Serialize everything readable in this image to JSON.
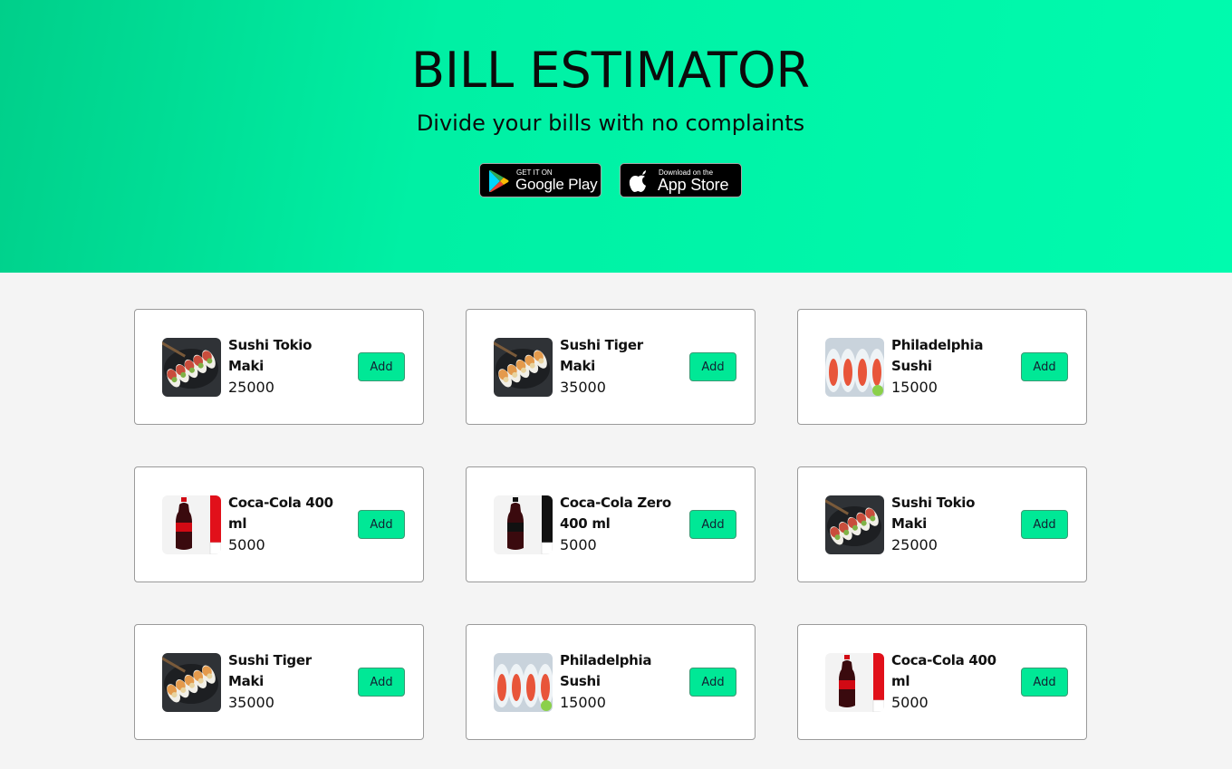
{
  "hero": {
    "title": "BILL ESTIMATOR",
    "subtitle": "Divide your bills with no complaints",
    "google_play": {
      "small": "GET IT ON",
      "big": "Google Play"
    },
    "app_store": {
      "small": "Download on the",
      "big": "App Store"
    }
  },
  "colors": {
    "accent": "#00e896",
    "hero_bg": "#00f0a4",
    "page_bg": "#f4f4f4"
  },
  "products": [
    {
      "name": "Sushi Tokio Maki",
      "price": "25000",
      "image": "sushi-tokio",
      "button": "Add"
    },
    {
      "name": "Sushi Tiger Maki",
      "price": "35000",
      "image": "sushi-tiger",
      "button": "Add"
    },
    {
      "name": "Philadelphia Sushi",
      "price": "15000",
      "image": "sushi-philadelphia",
      "button": "Add"
    },
    {
      "name": "Coca-Cola 400 ml",
      "price": "5000",
      "image": "coca-cola",
      "button": "Add"
    },
    {
      "name": "Coca-Cola Zero 400 ml",
      "price": "5000",
      "image": "coca-cola-zero",
      "button": "Add"
    },
    {
      "name": "Sushi Tokio Maki",
      "price": "25000",
      "image": "sushi-tokio",
      "button": "Add"
    },
    {
      "name": "Sushi Tiger Maki",
      "price": "35000",
      "image": "sushi-tiger",
      "button": "Add"
    },
    {
      "name": "Philadelphia Sushi",
      "price": "15000",
      "image": "sushi-philadelphia",
      "button": "Add"
    },
    {
      "name": "Coca-Cola 400 ml",
      "price": "5000",
      "image": "coca-cola",
      "button": "Add"
    }
  ]
}
